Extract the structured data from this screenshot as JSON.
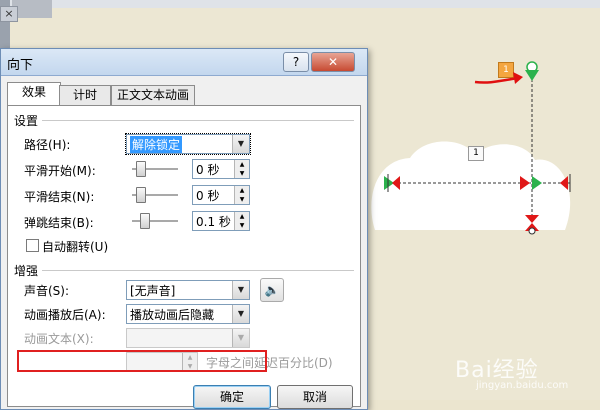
{
  "dialog": {
    "title": "向下",
    "help_label": "?",
    "close_label": "✕",
    "tabs": [
      {
        "label": "效果",
        "active": true
      },
      {
        "label": "计时",
        "active": false
      },
      {
        "label": "正文文本动画",
        "active": false
      }
    ],
    "settings": {
      "section_title": "设置",
      "path_label": "路径(H):",
      "path_value": "解除锁定",
      "smooth_start_label": "平滑开始(M):",
      "smooth_start_value": "0 秒",
      "smooth_end_label": "平滑结束(N):",
      "smooth_end_value": "0 秒",
      "bounce_end_label": "弹跳结束(B):",
      "bounce_end_value": "0.1 秒",
      "auto_reverse_label": "自动翻转(U)",
      "auto_reverse_checked": false
    },
    "enhancements": {
      "section_title": "增强",
      "sound_label": "声音(S):",
      "sound_value": "[无声音]",
      "after_animation_label": "动画播放后(A):",
      "after_animation_value": "播放动画后隐藏",
      "animate_text_label": "动画文本(X):",
      "animate_text_value": "",
      "delay_label": "字母之间延迟百分比(D)"
    },
    "ok_label": "确定",
    "cancel_label": "取消"
  },
  "canvas": {
    "close_glyph": "×",
    "orange_tag": "1",
    "path_tag": "1",
    "arrow_color": "#e01010",
    "watermark": "Bai经验",
    "watermark_sub": "jingyan.baidu.com"
  },
  "colors": {
    "highlight": "#e02020",
    "path_start": "#2bb24c",
    "path_end": "#e01818",
    "slide_bg": "#ece7d3"
  }
}
